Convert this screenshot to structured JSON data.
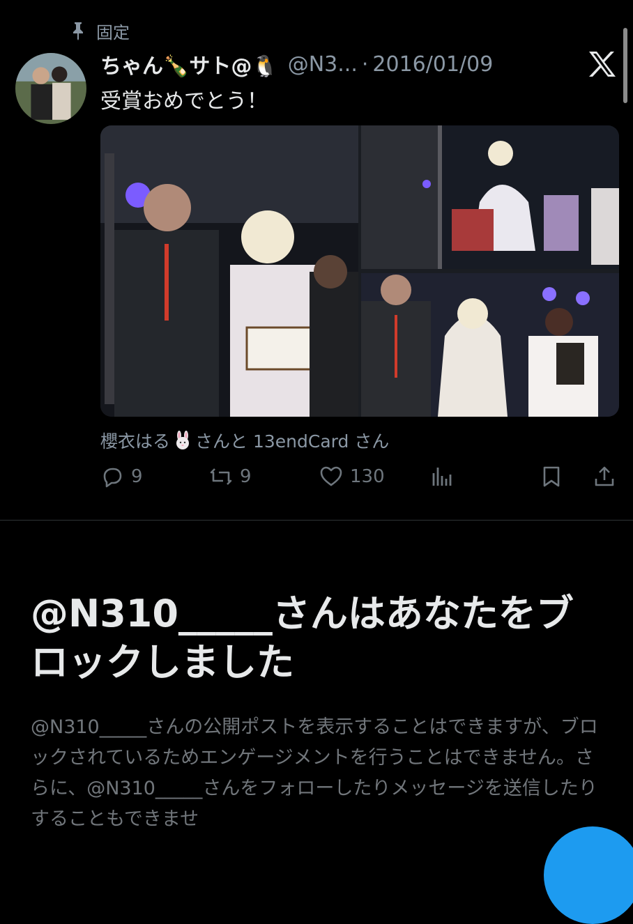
{
  "pinned_label": "固定",
  "tweet": {
    "display_name": "ちゃん🍾サト@🐧",
    "handle": "@N3...",
    "separator": "·",
    "date": "2016/01/09",
    "text": "受賞おめでとう！",
    "tagged_text_a": "櫻衣はる",
    "tagged_text_b": "さんと 13endCard さん"
  },
  "stats": {
    "replies": "9",
    "reposts": "9",
    "likes": "130"
  },
  "blocked": {
    "title": "@N310_____さんはあなたをブロックしました",
    "body": "@N310_____さんの公開ポストを表示することはできますが、ブロックされているためエンゲージメントを行うことはできません。さらに、@N310_____さんをフォローしたりメッセージを送信したりすることもできませ"
  },
  "colors": {
    "background": "#000000",
    "text_primary": "#e7e9ea",
    "text_secondary": "#8b98a5",
    "divider": "#2f3336",
    "accent": "#1d9bf0"
  },
  "icons": [
    "pin-icon",
    "x-logo-icon",
    "rabbit-emoji-icon",
    "reply-icon",
    "repost-icon",
    "like-icon",
    "views-icon",
    "bookmark-icon",
    "share-icon"
  ]
}
